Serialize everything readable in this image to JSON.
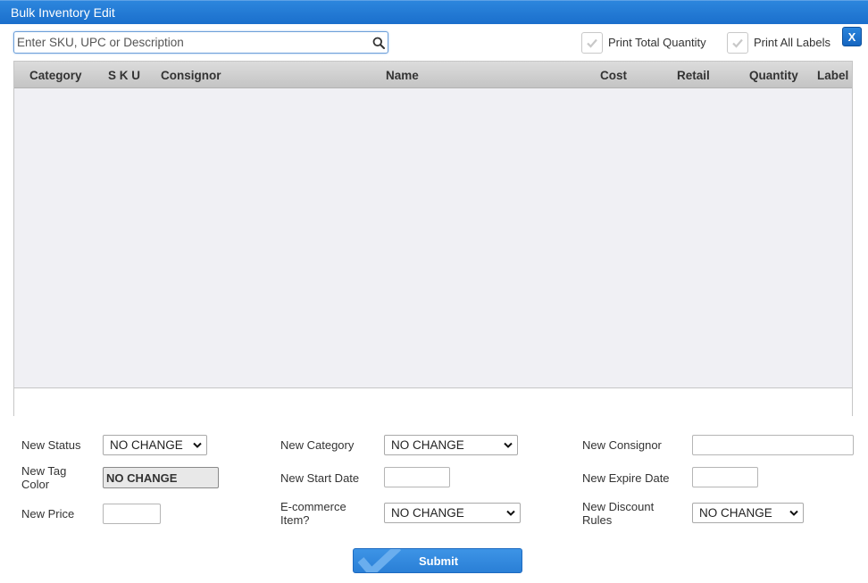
{
  "window": {
    "title": "Bulk Inventory Edit",
    "close_label": "X"
  },
  "search": {
    "placeholder": "Enter SKU, UPC or Description"
  },
  "options": {
    "print_total_quantity": {
      "label": "Print Total Quantity",
      "checked": true
    },
    "print_all_labels": {
      "label": "Print All Labels",
      "checked": true
    }
  },
  "grid": {
    "columns": [
      "Category",
      "S K U",
      "Consignor",
      "Name",
      "Cost",
      "Retail",
      "Quantity",
      "Label"
    ],
    "rows": []
  },
  "form": {
    "new_status": {
      "label": "New Status",
      "value": "NO CHANGE"
    },
    "new_tag_color": {
      "label": "New Tag Color",
      "value": "NO CHANGE"
    },
    "new_price": {
      "label": "New Price",
      "value": ""
    },
    "new_category": {
      "label": "New Category",
      "value": "NO CHANGE"
    },
    "new_start_date": {
      "label": "New Start Date",
      "value": ""
    },
    "ecommerce_item": {
      "label": "E-commerce Item?",
      "value": "NO CHANGE"
    },
    "new_consignor": {
      "label": "New Consignor",
      "value": ""
    },
    "new_expire_date": {
      "label": "New Expire Date",
      "value": ""
    },
    "new_discount_rules": {
      "label": "New Discount Rules",
      "value": "NO CHANGE"
    }
  },
  "submit": {
    "label": "Submit"
  },
  "colors": {
    "accent": "#1f75d0",
    "check": "#c8c8c8"
  }
}
